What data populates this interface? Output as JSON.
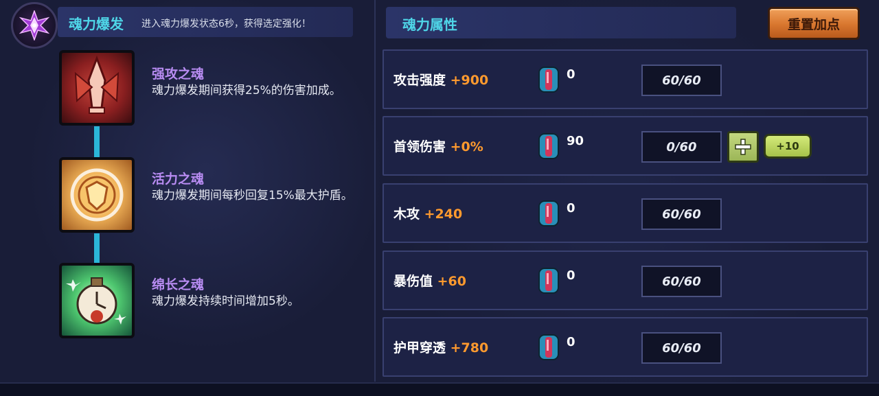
{
  "burst": {
    "title": "魂力爆发",
    "description": "进入魂力爆发状态6秒，获得选定强化！"
  },
  "souls": [
    {
      "name": "强攻之魂",
      "description": "魂力爆发期间获得25%的伤害加成。",
      "color": "#b8322c"
    },
    {
      "name": "活力之魂",
      "description": "魂力爆发期间每秒回复15%最大护盾。",
      "color": "#f2b55a"
    },
    {
      "name": "绵长之魂",
      "description": "魂力爆发持续时间增加5秒。",
      "color": "#4fc870"
    }
  ],
  "attributes": {
    "title": "魂力属性",
    "reset_label": "重置加点",
    "rows": [
      {
        "label": "攻击强度",
        "bonus": "+900",
        "potions": "0",
        "points": "60/60"
      },
      {
        "label": "首领伤害",
        "bonus": "+0%",
        "potions": "90",
        "points": "0/60",
        "plus10_label": "+10"
      },
      {
        "label": "木攻",
        "bonus": "+240",
        "potions": "0",
        "points": "60/60"
      },
      {
        "label": "暴伤值",
        "bonus": "+60",
        "potions": "0",
        "points": "60/60"
      },
      {
        "label": "护甲穿透",
        "bonus": "+780",
        "potions": "0",
        "points": "60/60"
      }
    ]
  },
  "colors": {
    "accent_cyan": "#4fd6e8",
    "soul_name": "#b88cf2",
    "bonus_orange": "#ff9a2e",
    "reset_orange": "#d8762e",
    "plus_green": "#9cb657"
  },
  "icons": {
    "burst": "purple-crystal-icon",
    "potion": "soul-potion-icon",
    "plus": "plus-icon"
  }
}
